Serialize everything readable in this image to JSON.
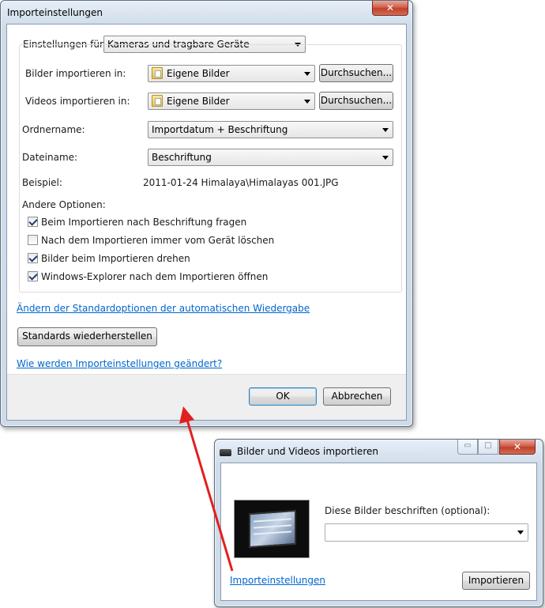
{
  "import_settings": {
    "title": "Importeinstellungen",
    "close_glyph": "✕",
    "settings_for_label": "Einstellungen für:",
    "settings_for_value": "Kameras und tragbare Geräte",
    "images_label": "Bilder importieren in:",
    "images_value": "Eigene Bilder",
    "videos_label": "Videos importieren in:",
    "videos_value": "Eigene Bilder",
    "browse_label": "Durchsuchen...",
    "folder_name_label": "Ordnername:",
    "folder_name_value": "Importdatum + Beschriftung",
    "file_name_label": "Dateiname:",
    "file_name_value": "Beschriftung",
    "example_label": "Beispiel:",
    "example_value": "2011-01-24 Himalaya\\Himalayas 001.JPG",
    "other_options_label": "Andere Optionen:",
    "options": [
      {
        "label": "Beim Importieren nach Beschriftung fragen",
        "checked": true
      },
      {
        "label": "Nach dem Importieren immer vom Gerät löschen",
        "checked": false
      },
      {
        "label": "Bilder beim Importieren drehen",
        "checked": true
      },
      {
        "label": "Windows-Explorer nach dem Importieren öffnen",
        "checked": true
      }
    ],
    "autoplay_link": "Ändern der Standardoptionen der automatischen Wiedergabe",
    "restore_defaults": "Standards wiederherstellen",
    "help_link": "Wie werden Importeinstellungen geändert?",
    "ok": "OK",
    "cancel": "Abbrechen"
  },
  "import_dialog": {
    "title": "Bilder und Videos importieren",
    "minimize_glyph": "▭",
    "maximize_glyph": "□",
    "close_glyph": "✕",
    "tag_label": "Diese Bilder beschriften (optional):",
    "tag_value": "",
    "settings_link": "Importeinstellungen",
    "import_button": "Importieren"
  },
  "colors": {
    "annotation_arrow": "#e02020",
    "link": "#0066cc"
  }
}
